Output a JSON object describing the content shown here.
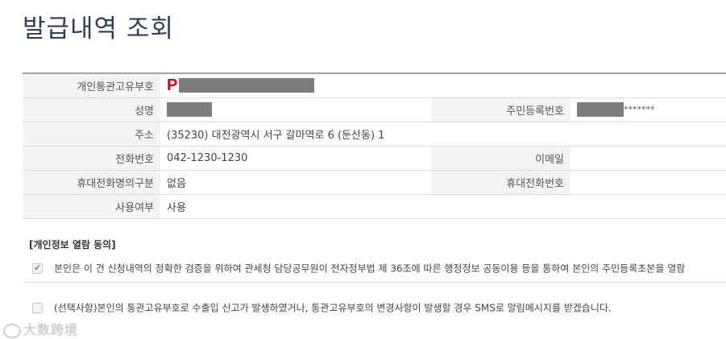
{
  "page": {
    "title": "발급내역 조회"
  },
  "info": {
    "customs_id_label": "개인통관고유부호",
    "customs_id_prefix": "P",
    "name_label": "성명",
    "rrn_label": "주민등록번호",
    "rrn_masked": "*******",
    "address_label": "주소",
    "address_value": "(35230)  대전광역시 서구 갈마역로 6 (둔산동) 1",
    "phone_label": "전화번호",
    "phone_value": "042-1230-1230",
    "email_label": "이메일",
    "email_value": "",
    "mobile_owner_label": "휴대전화명의구분",
    "mobile_owner_value": "없음",
    "mobile_label": "휴대전화번호",
    "mobile_value": "",
    "usage_label": "사용여부",
    "usage_value": "사용"
  },
  "consent": {
    "title": "[개인정보 열람 동의]",
    "items": [
      {
        "text": "본인은 이 건 신청내역의 정확한 검증을 위하여 관세청 담당공무원이 전자정부법 제 36조에 따른 행정정보 공동이용 등을 통하여 본인의 주민등록초본을 열람",
        "checked": true
      },
      {
        "text": "(선택사항)본인의 통관고유부호로 수출입 신고가 발생하였거나, 통관고유부호의 변경사항이 발생할 경우 SMS로 알림메시지를 받겠습니다.",
        "checked": false
      }
    ]
  },
  "watermark": {
    "text": "大数跨境"
  }
}
